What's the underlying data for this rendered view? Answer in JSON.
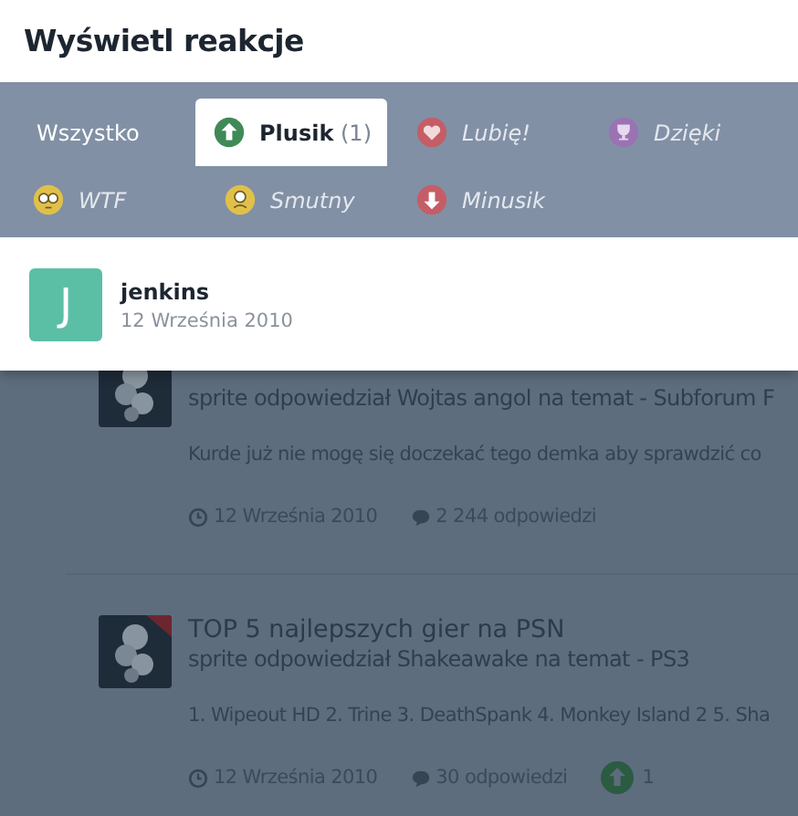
{
  "dialog": {
    "title": "Wyświetl reakcje",
    "tab_rows": [
      [
        {
          "label": "Wszystko",
          "selected": false
        },
        {
          "label": "Plusik",
          "count": "(1)",
          "kind": "up",
          "color": "#3f8a57",
          "selected": true
        },
        {
          "label": "Lubię!",
          "kind": "heart",
          "color": "#c55d67",
          "selected": false
        },
        {
          "label": "Dzięki",
          "kind": "trophy",
          "color": "#9b72b3",
          "selected": false
        }
      ],
      [
        {
          "label": "WTF",
          "kind": "wtf",
          "color": "#e1c04a",
          "selected": false
        },
        {
          "label": "Smutny",
          "kind": "sad",
          "color": "#e1c04a",
          "selected": false
        },
        {
          "label": "Minusik",
          "kind": "down",
          "color": "#c55d67",
          "selected": false
        }
      ]
    ],
    "users": [
      {
        "initial": "J",
        "name": "jenkins",
        "date": "12 Września 2010",
        "color": "#5bbfa5"
      }
    ]
  },
  "posts": [
    {
      "subtitle": "sprite odpowiedział Wojtas angol na temat - Subforum F",
      "excerpt": "Kurde już nie mogę się doczekać tego demka aby sprawdzić co",
      "date": "12 Września 2010",
      "replies": "2 244 odpowiedzi"
    },
    {
      "title": "TOP 5 najlepszych gier na PSN",
      "subtitle": "sprite odpowiedział Shakeawake na temat - PS3",
      "excerpt": "1. Wipeout HD 2. Trine 3. DeathSpank 4. Monkey Island 2 5. Sha",
      "date": "12 Września 2010",
      "replies": "30 odpowiedzi",
      "reaction_count": "1"
    }
  ]
}
